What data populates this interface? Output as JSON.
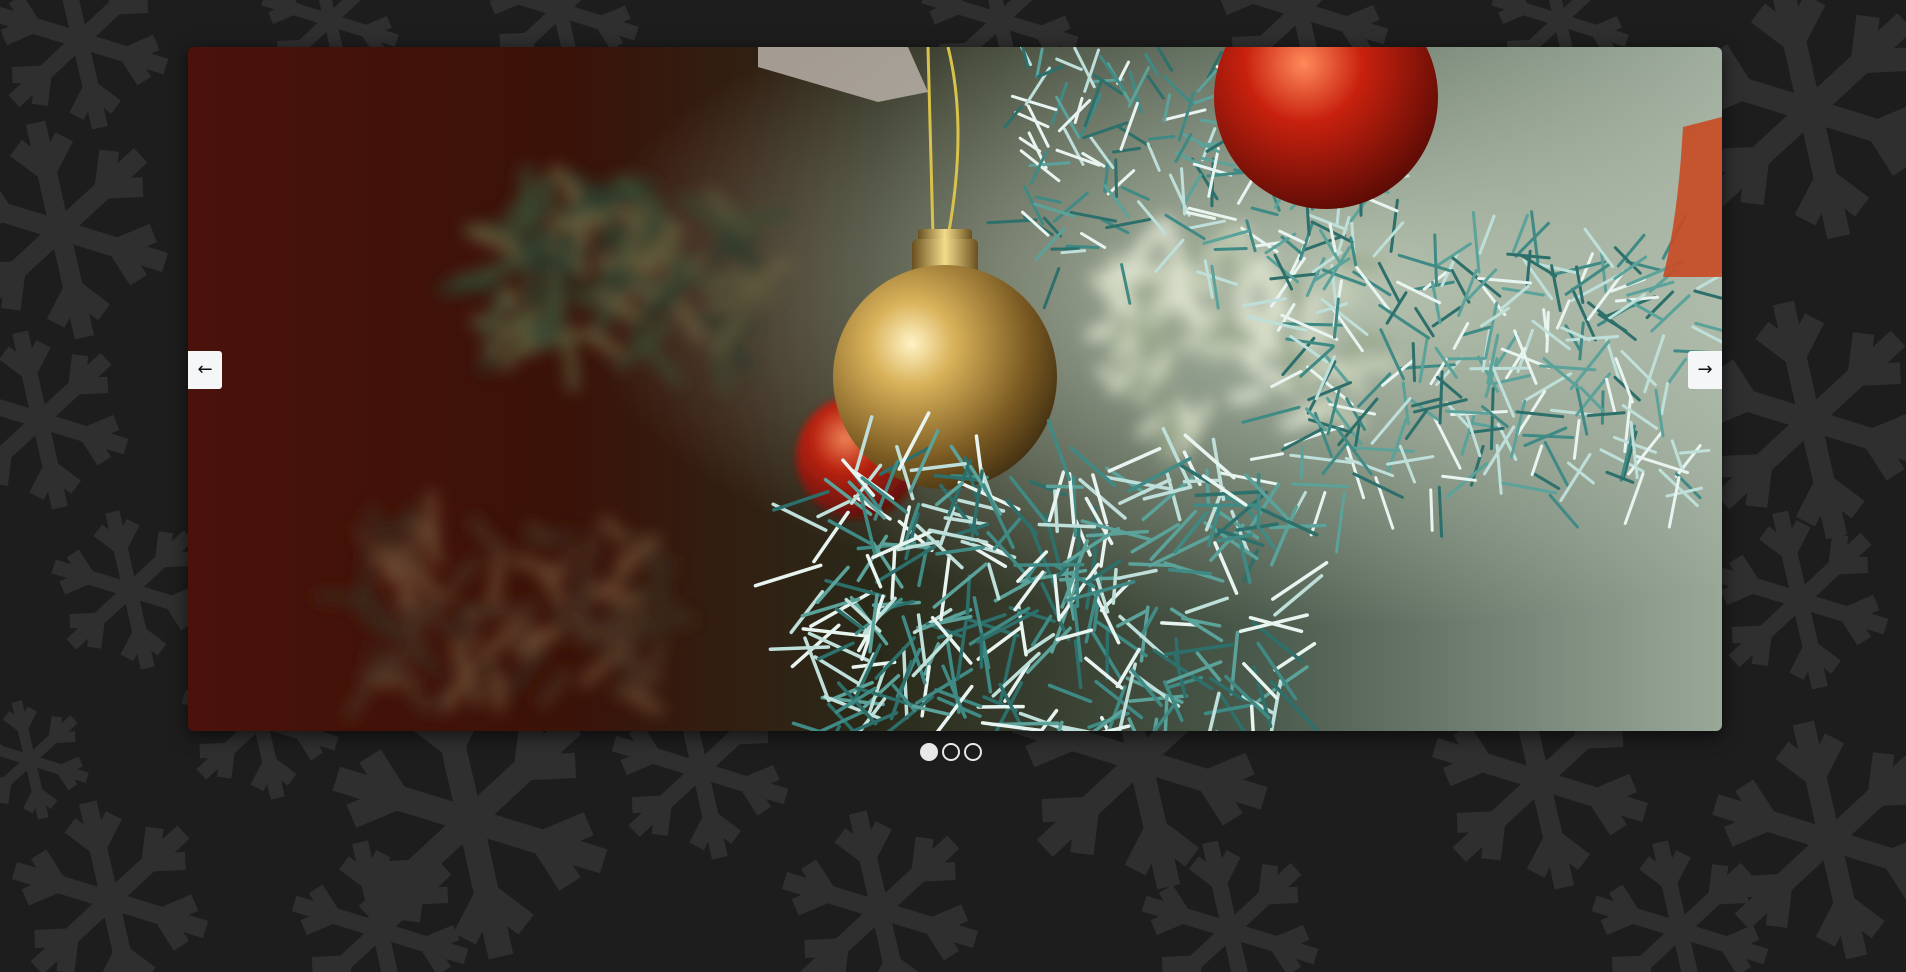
{
  "background": {
    "color": "#1d1d1d",
    "pattern_icon": "snowflake-icon",
    "pattern_color": "#2f2f2f"
  },
  "carousel": {
    "slide_image_icon": "christmas-ornament-photo",
    "prev_icon": "arrow-left-icon",
    "next_icon": "arrow-right-icon",
    "prev_glyph": "←",
    "next_glyph": "→",
    "active_index": 0,
    "slide_count": 3
  }
}
